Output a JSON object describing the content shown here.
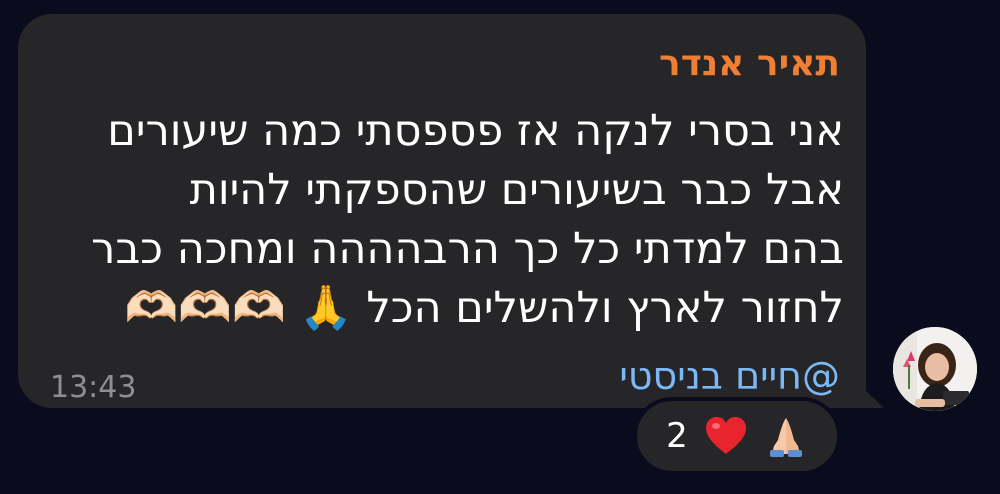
{
  "message": {
    "sender": "תאיר אנדר",
    "lines": [
      "אני בסרי לנקה אז פספסתי כמה שיעורים",
      "אבל כבר בשיעורים שהספקתי להיות",
      "בהם למדתי כל כך הרבהההה ומחכה כבר",
      "לחזור לארץ ולהשלים הכל 🙏 🫶🏻🫶🏻🫶🏻"
    ],
    "mention": "@חיים בניסטי",
    "timestamp": "13:43"
  },
  "reactions": {
    "count": "2",
    "icons": [
      "heart-icon",
      "pray-icon"
    ]
  },
  "colors": {
    "background": "#0b0b1e",
    "bubble": "#262628",
    "sender": "#f07f36",
    "mention": "#7cb8f5",
    "timestamp": "#8e8e93",
    "heart": "#e8242f"
  }
}
